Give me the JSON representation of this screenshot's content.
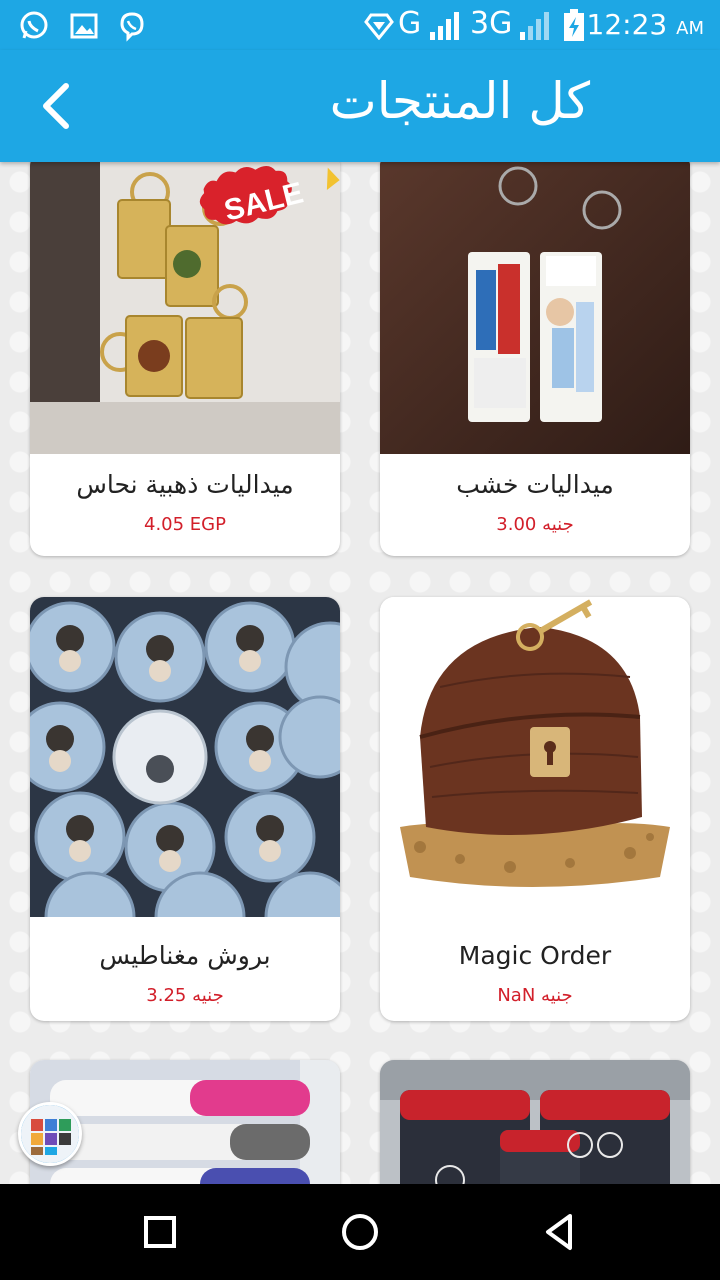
{
  "status_bar": {
    "network_label": "G",
    "network2_label": "3G",
    "time": "12:23",
    "ampm": "AM"
  },
  "app_bar": {
    "title": "كل المنتجات"
  },
  "products": [
    {
      "name": "ميداليات ذهبية نحاس",
      "price": "4.05 EGP",
      "sale_badge": "SALE"
    },
    {
      "name": "ميداليات خشب",
      "price": "3.00 جنيه"
    },
    {
      "name": "بروش مغناطيس",
      "price": "3.25 جنيه"
    },
    {
      "name": "Magic Order",
      "price": "NaN جنيه"
    }
  ],
  "colors": {
    "primary": "#1ea7e4",
    "price": "#d21f2a",
    "background": "#ececec"
  }
}
